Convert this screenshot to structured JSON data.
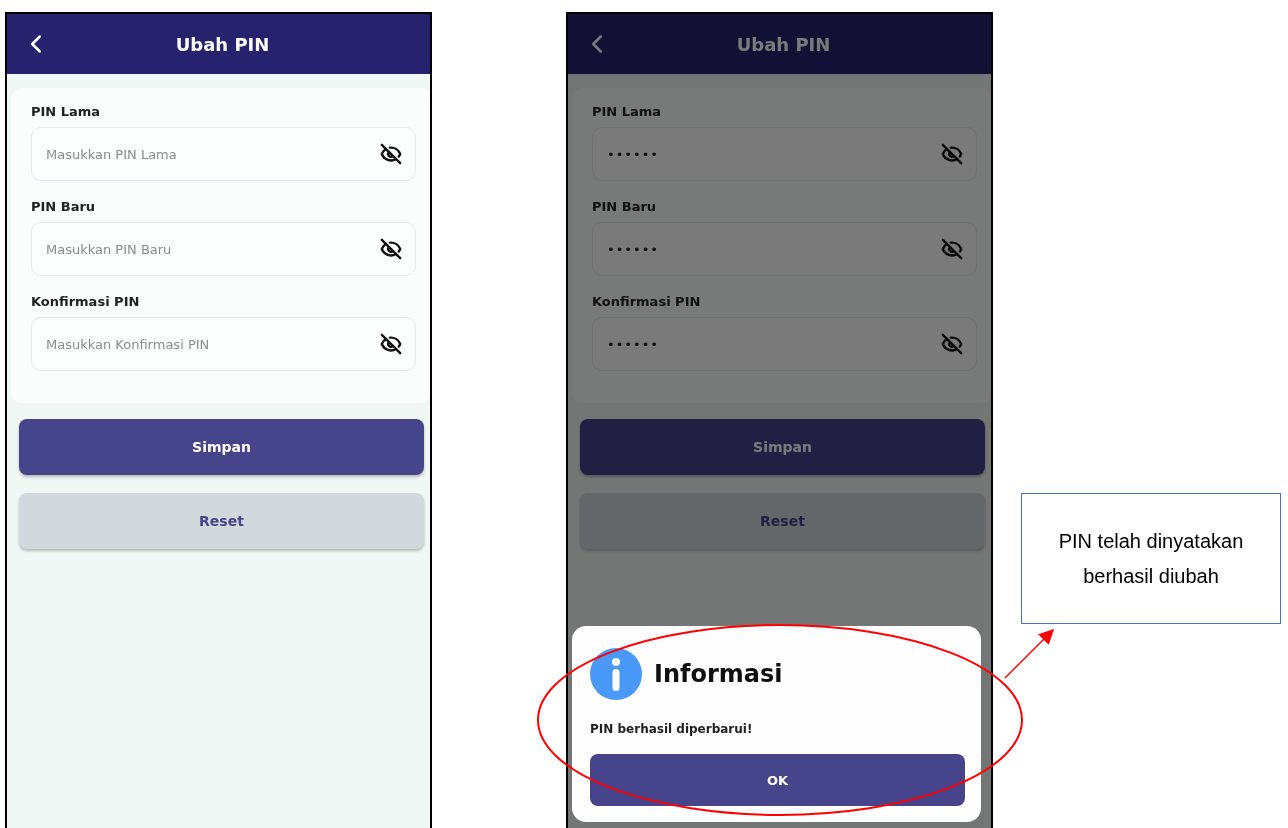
{
  "screens": [
    {
      "title": "Ubah PIN",
      "dimmed": false,
      "fields": [
        {
          "label": "PIN Lama",
          "placeholder": "Masukkan PIN Lama"
        },
        {
          "label": "PIN Baru",
          "placeholder": "Masukkan PIN Baru"
        },
        {
          "label": "Konfirmasi PIN",
          "placeholder": "Masukkan Konfirmasi PIN"
        }
      ],
      "buttons": [
        {
          "label": "Simpan",
          "kind": "primary"
        },
        {
          "label": "Reset",
          "kind": "secondary"
        }
      ]
    },
    {
      "title": "Ubah PIN",
      "dimmed": true,
      "fields": [
        {
          "label": "PIN Lama",
          "value": "••••••"
        },
        {
          "label": "PIN Baru",
          "value": "••••••"
        },
        {
          "label": "Konfirmasi PIN",
          "value": "••••••"
        }
      ],
      "buttons": [
        {
          "label": "Simpan",
          "kind": "primary"
        },
        {
          "label": "Reset",
          "kind": "secondary"
        }
      ],
      "dialog": {
        "title": "Informasi",
        "message": "PIN berhasil diperbarui!",
        "button": "OK"
      }
    }
  ],
  "annotation": {
    "text": "PIN telah dinyatakan berhasil diubah"
  }
}
